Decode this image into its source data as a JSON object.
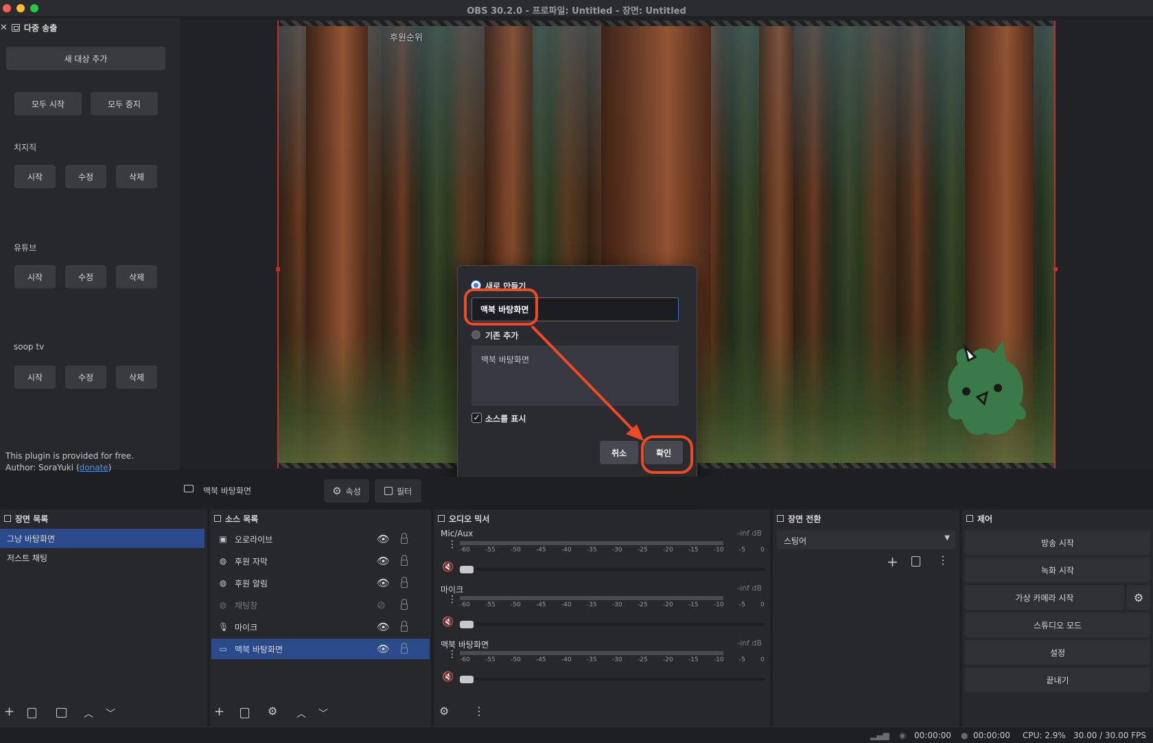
{
  "window": {
    "title": "OBS 30.2.0 - 프로파일: Untitled - 장면: Untitled",
    "traffic_colors": [
      "#ff5f57",
      "#febc2e",
      "#28c840"
    ]
  },
  "multistream": {
    "dock_title": "다중 송출",
    "add_target": "새 대상 추가",
    "start_all": "모두 시작",
    "stop_all": "모두 중지",
    "targets": [
      {
        "name": "치지직",
        "start": "시작",
        "edit": "수정",
        "delete": "삭제"
      },
      {
        "name": "유튜브",
        "start": "시작",
        "edit": "수정",
        "delete": "삭제"
      },
      {
        "name": "soop tv",
        "start": "시작",
        "edit": "수정",
        "delete": "삭제"
      }
    ],
    "note_line1": "This plugin is provided for free.",
    "note_author": "Author: SoraYuki (",
    "note_link": "donate",
    "note_close": ")"
  },
  "preview": {
    "overlay_text": "후원순위"
  },
  "dialog": {
    "create_new": "새로 만들기",
    "name_value": "맥북 바탕화면",
    "add_existing": "기존 추가",
    "existing_items": [
      "맥북 바탕화면"
    ],
    "show_source": "소스를 표시",
    "show_source_checked": true,
    "cancel": "취소",
    "ok": "확인",
    "accent": "#ef4a22"
  },
  "source_toolbar": {
    "selected_source": "맥북 바탕화면",
    "properties": "속성",
    "filters": "필터"
  },
  "scenes": {
    "title": "장면 목록",
    "items": [
      "그냥 바탕화면",
      "저스트 채팅"
    ],
    "selected_index": 0
  },
  "sources": {
    "title": "소스 목록",
    "items": [
      {
        "name": "오로라이브",
        "icon": "image-icon",
        "visible": true
      },
      {
        "name": "후원 자막",
        "icon": "browser-icon",
        "visible": true
      },
      {
        "name": "후원 알림",
        "icon": "browser-icon",
        "visible": true
      },
      {
        "name": "채팅창",
        "icon": "browser-icon",
        "visible": false
      },
      {
        "name": "마이크",
        "icon": "mic-icon",
        "visible": true
      },
      {
        "name": "맥북 바탕화면",
        "icon": "display-icon",
        "visible": true
      }
    ],
    "selected_index": 5
  },
  "mixer": {
    "title": "오디오 믹서",
    "tracks": [
      {
        "name": "Mic/Aux",
        "db": "-inf dB"
      },
      {
        "name": "마이크",
        "db": "-inf dB"
      },
      {
        "name": "맥북 바탕화면",
        "db": "-inf dB"
      }
    ],
    "ticks": [
      "-60",
      "-55",
      "-50",
      "-45",
      "-40",
      "-35",
      "-30",
      "-25",
      "-20",
      "-15",
      "-10",
      "-5",
      "0"
    ]
  },
  "transitions": {
    "title": "장면 전환",
    "selected": "스팅어"
  },
  "controls": {
    "title": "제어",
    "start_stream": "방송 시작",
    "start_record": "녹화 시작",
    "virtual_cam": "가상 카메라 시작",
    "studio_mode": "스튜디오 모드",
    "settings": "설정",
    "exit": "끝내기"
  },
  "status": {
    "stream_time": "00:00:00",
    "record_time": "00:00:00",
    "cpu": "CPU: 2.9%",
    "fps": "30.00 / 30.00 FPS"
  }
}
